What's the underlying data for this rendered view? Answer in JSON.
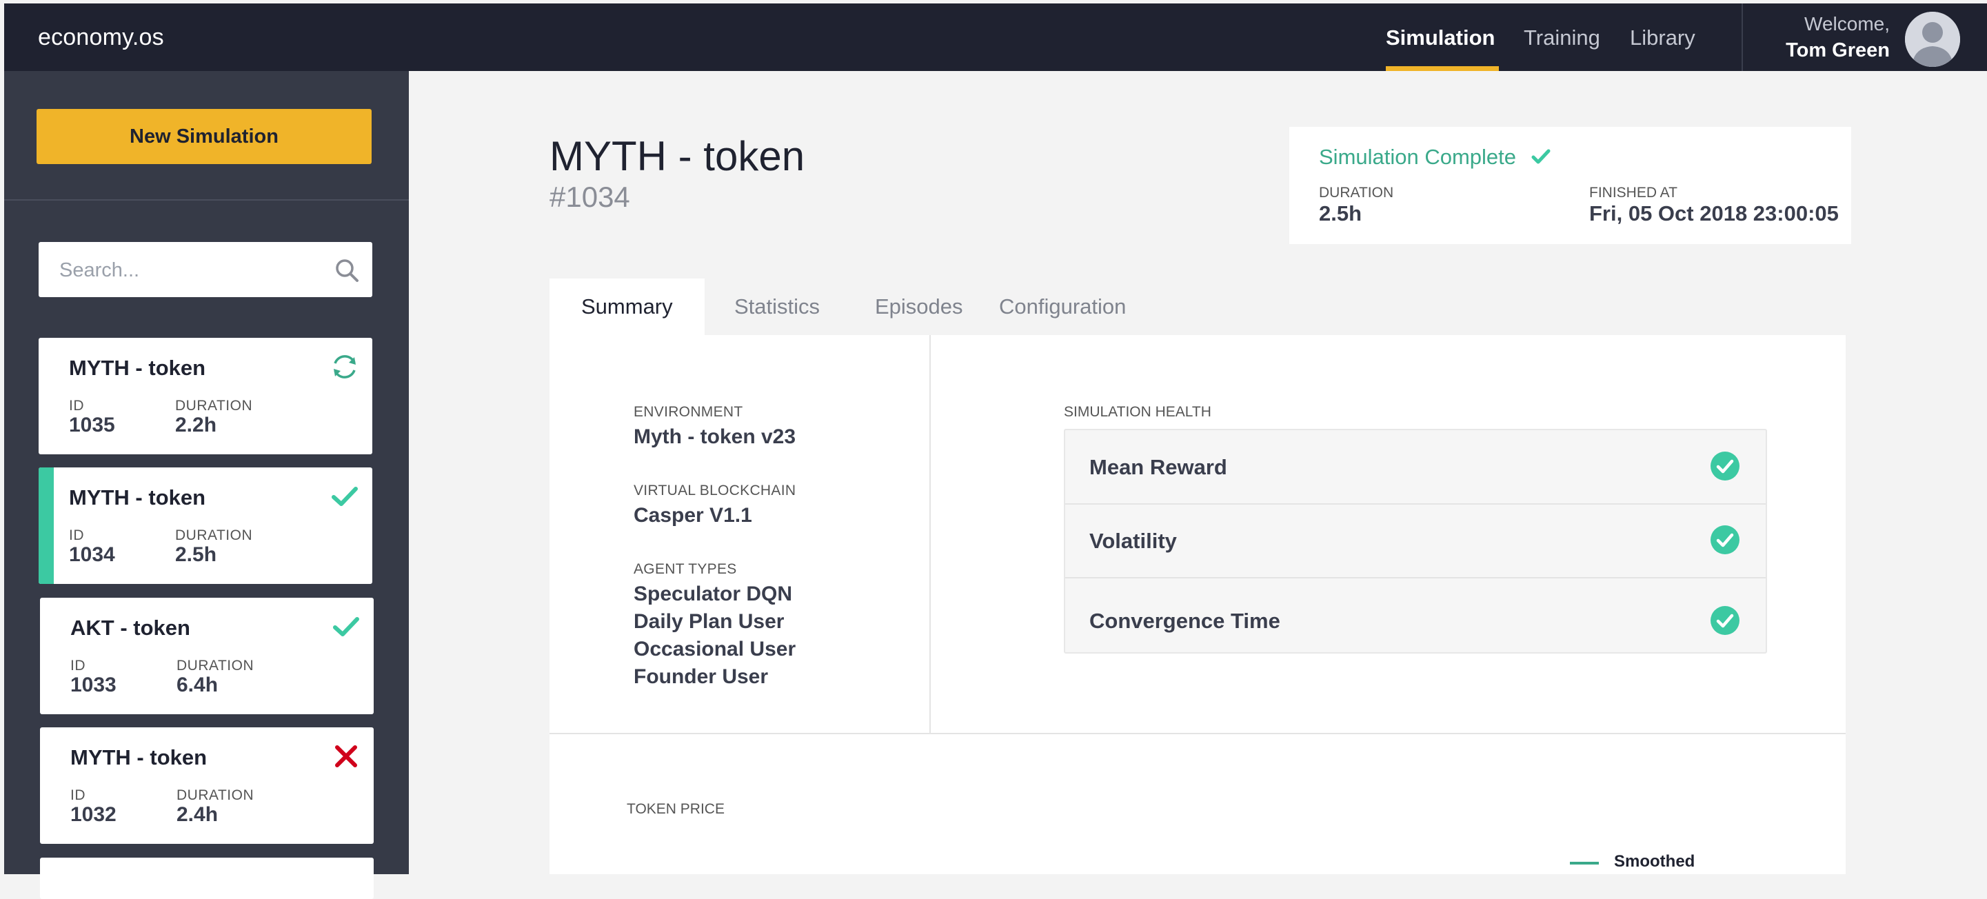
{
  "app": {
    "logo": "economy.os"
  },
  "nav": {
    "items": [
      {
        "label": "Simulation",
        "active": true
      },
      {
        "label": "Training",
        "active": false
      },
      {
        "label": "Library",
        "active": false
      }
    ],
    "welcome": "Welcome,",
    "user_name": "Tom Green",
    "accent_color": "#f0b429"
  },
  "sidebar": {
    "new_button": "New Simulation",
    "search_placeholder": "Search...",
    "id_label": "ID",
    "duration_label": "DURATION",
    "simulations": [
      {
        "title": "MYTH - token",
        "id": "1035",
        "duration": "2.2h",
        "status": "running",
        "status_icon": "sync-icon"
      },
      {
        "title": "MYTH - token",
        "id": "1034",
        "duration": "2.5h",
        "status": "complete",
        "status_icon": "check-icon",
        "selected": true
      },
      {
        "title": "AKT - token",
        "id": "1033",
        "duration": "6.4h",
        "status": "complete",
        "status_icon": "check-icon"
      },
      {
        "title": "MYTH - token",
        "id": "1032",
        "duration": "2.4h",
        "status": "failed",
        "status_icon": "x-icon"
      }
    ]
  },
  "header": {
    "title": "MYTH - token",
    "id": "#1034"
  },
  "status_panel": {
    "status": "Simulation Complete",
    "duration_label": "DURATION",
    "duration": "2.5h",
    "finished_label": "FINISHED AT",
    "finished": "Fri, 05 Oct 2018 23:00:05",
    "success_color": "#3aa98a"
  },
  "tabs": [
    {
      "label": "Summary",
      "active": true
    },
    {
      "label": "Statistics"
    },
    {
      "label": "Episodes"
    },
    {
      "label": "Configuration"
    }
  ],
  "summary": {
    "environment_label": "ENVIRONMENT",
    "environment": "Myth - token v23",
    "blockchain_label": "VIRTUAL BLOCKCHAIN",
    "blockchain": "Casper V1.1",
    "agent_types_label": "AGENT TYPES",
    "agent_types": [
      "Speculator DQN",
      "Daily Plan User",
      "Occasional User",
      "Founder User"
    ],
    "health_label": "SIMULATION HEALTH",
    "health": [
      {
        "name": "Mean Reward",
        "ok": true
      },
      {
        "name": "Volatility",
        "ok": true
      },
      {
        "name": "Convergence Time",
        "ok": true
      }
    ],
    "token_price_label": "TOKEN PRICE",
    "legend_smoothed": "Smoothed"
  }
}
